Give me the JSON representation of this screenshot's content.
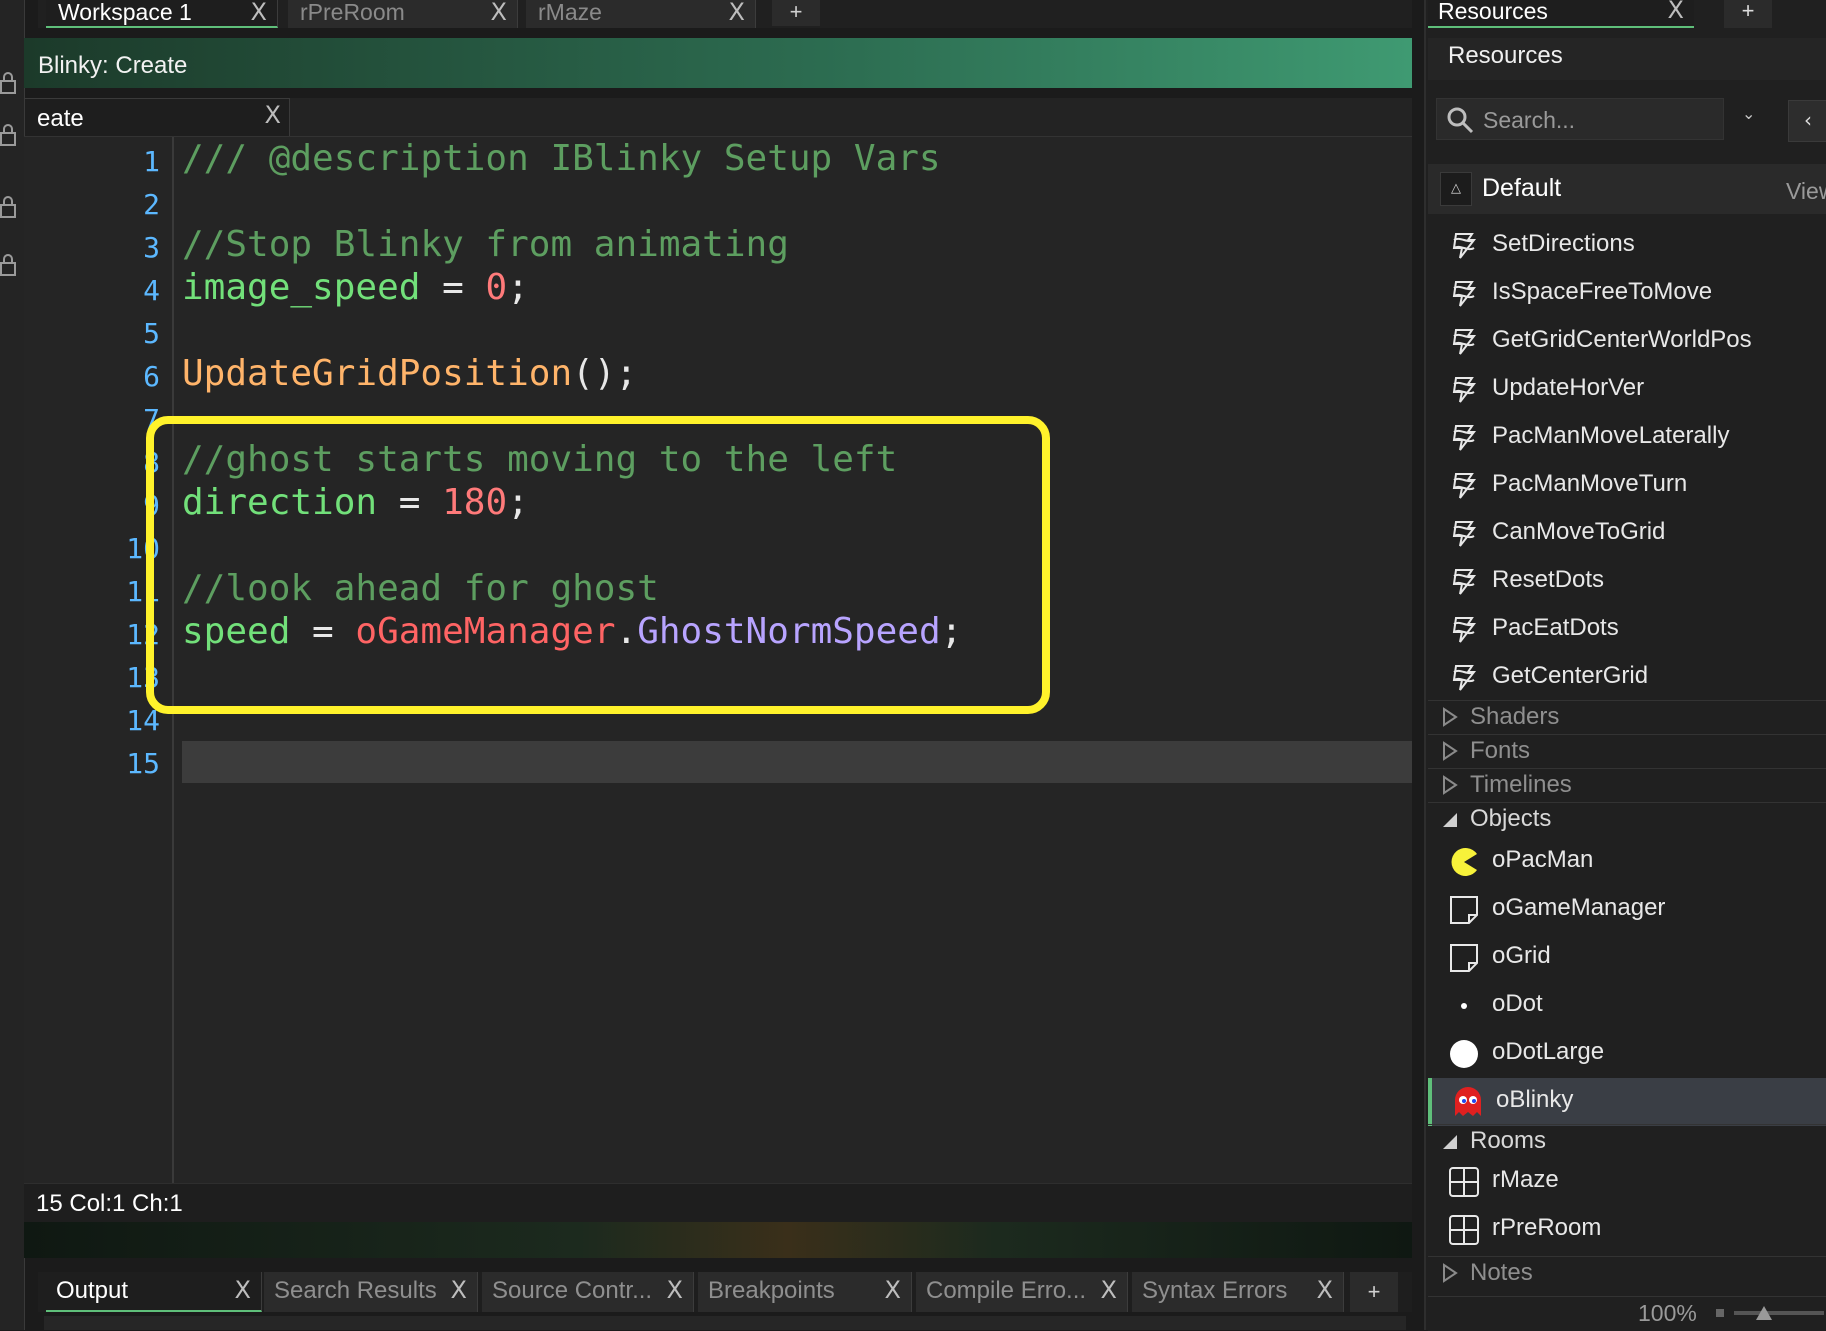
{
  "workspace_tabs": [
    {
      "label": "Workspace 1",
      "active": true
    },
    {
      "label": "rPreRoom",
      "active": false
    },
    {
      "label": "rMaze",
      "active": false
    }
  ],
  "editor": {
    "title": "Blinky: Create",
    "event_tab": "eate",
    "status": "15 Col:1 Ch:1",
    "line_numbers": [
      "1",
      "2",
      "3",
      "4",
      "5",
      "6",
      "7",
      "8",
      "9",
      "10",
      "11",
      "12",
      "13",
      "14",
      "15"
    ],
    "lines": {
      "l1": "/// @description IBlinky Setup Vars",
      "l3": "//Stop Blinky from animating",
      "l4_var": "image_speed",
      "l4_op": " = ",
      "l4_num": "0",
      "l4_end": ";",
      "l6_func": "UpdateGridPosition",
      "l6_end": "();",
      "l8": "//ghost starts moving to the left",
      "l9_var": "direction",
      "l9_op": " = ",
      "l9_num": "180",
      "l9_end": ";",
      "l11": "//look ahead for ghost",
      "l12_var": "speed",
      "l12_op": " = ",
      "l12_obj": "oGameManager",
      "l12_dot": ".",
      "l12_prop": "GhostNormSpeed",
      "l12_end": ";"
    }
  },
  "output_tabs": [
    {
      "label": "Output",
      "active": true
    },
    {
      "label": "Search Results",
      "active": false
    },
    {
      "label": "Source Contr...",
      "active": false
    },
    {
      "label": "Breakpoints",
      "active": false
    },
    {
      "label": "Compile Erro...",
      "active": false
    },
    {
      "label": "Syntax Errors",
      "active": false
    }
  ],
  "resources": {
    "tab_label": "Resources",
    "header": "Resources",
    "search_placeholder": "Search...",
    "group": "Default",
    "view_label": "View",
    "scripts": [
      "SetDirections",
      "IsSpaceFreeToMove",
      "GetGridCenterWorldPos",
      "UpdateHorVer",
      "PacManMoveLaterally",
      "PacManMoveTurn",
      "CanMoveToGrid",
      "ResetDots",
      "PacEatDots",
      "GetCenterGrid"
    ],
    "folders_collapsed": [
      "Shaders",
      "Fonts",
      "Timelines"
    ],
    "objects_folder": "Objects",
    "objects": [
      "oPacMan",
      "oGameManager",
      "oGrid",
      "oDot",
      "oDotLarge",
      "oBlinky"
    ],
    "selected_object": "oBlinky",
    "rooms_folder": "Rooms",
    "rooms": [
      "rMaze",
      "rPreRoom"
    ],
    "notes_folder": "Notes",
    "zoom": "100%"
  },
  "colors": {
    "accent_green": "#5fbf7a",
    "highlight_yellow": "#fff22b",
    "comment": "#5d9e60",
    "variable": "#72e07a",
    "number": "#ff7a7a",
    "function": "#ffb46a",
    "object_ref": "#ff6464",
    "property": "#b8a4ff"
  }
}
